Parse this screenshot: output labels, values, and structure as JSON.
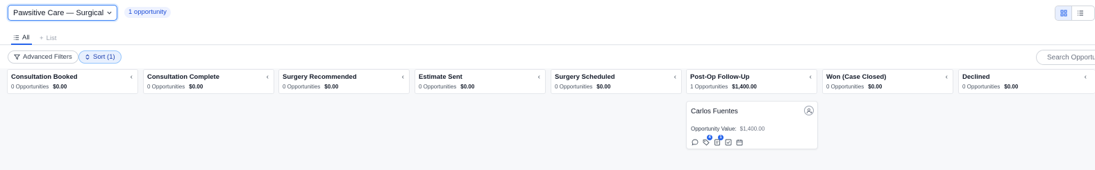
{
  "header": {
    "pipeline_select": "Pawsitive Care — Surgical ...",
    "opportunity_count": "1 opportunity",
    "view_modes": [
      "grid-icon",
      "list-icon"
    ],
    "active_view": "grid"
  },
  "tabs": [
    {
      "label": "All",
      "icon": "list-icon",
      "active": true
    },
    {
      "label": "List",
      "icon": "plus-icon",
      "active": false
    }
  ],
  "filters": {
    "advanced_filters_label": "Advanced Filters",
    "sort_label": "Sort (1)",
    "search_placeholder": "Search Opportunities"
  },
  "stages": [
    {
      "title": "Consultation Booked",
      "count": "0 Opportunities",
      "value": "$0.00"
    },
    {
      "title": "Consultation Complete",
      "count": "0 Opportunities",
      "value": "$0.00"
    },
    {
      "title": "Surgery Recommended",
      "count": "0 Opportunities",
      "value": "$0.00"
    },
    {
      "title": "Estimate Sent",
      "count": "0 Opportunities",
      "value": "$0.00"
    },
    {
      "title": "Surgery Scheduled",
      "count": "0 Opportunities",
      "value": "$0.00"
    },
    {
      "title": "Post-Op Follow-Up",
      "count": "1 Opportunities",
      "value": "$1,400.00"
    },
    {
      "title": "Won (Case Closed)",
      "count": "0 Opportunities",
      "value": "$0.00"
    },
    {
      "title": "Declined",
      "count": "0 Opportunities",
      "value": "$0.00"
    }
  ],
  "card": {
    "name": "Carlos Fuentes",
    "value_label": "Opportunity Value:",
    "value": "$1,400.00",
    "tag_count": "4",
    "task_count": "1",
    "actions": [
      "chat-icon",
      "tag-icon",
      "notes-icon",
      "task-check-icon",
      "calendar-icon"
    ]
  },
  "colors": {
    "accent": "#2563eb",
    "badge_bg": "#eef2ff",
    "sort_bg": "#e8f0fe"
  }
}
